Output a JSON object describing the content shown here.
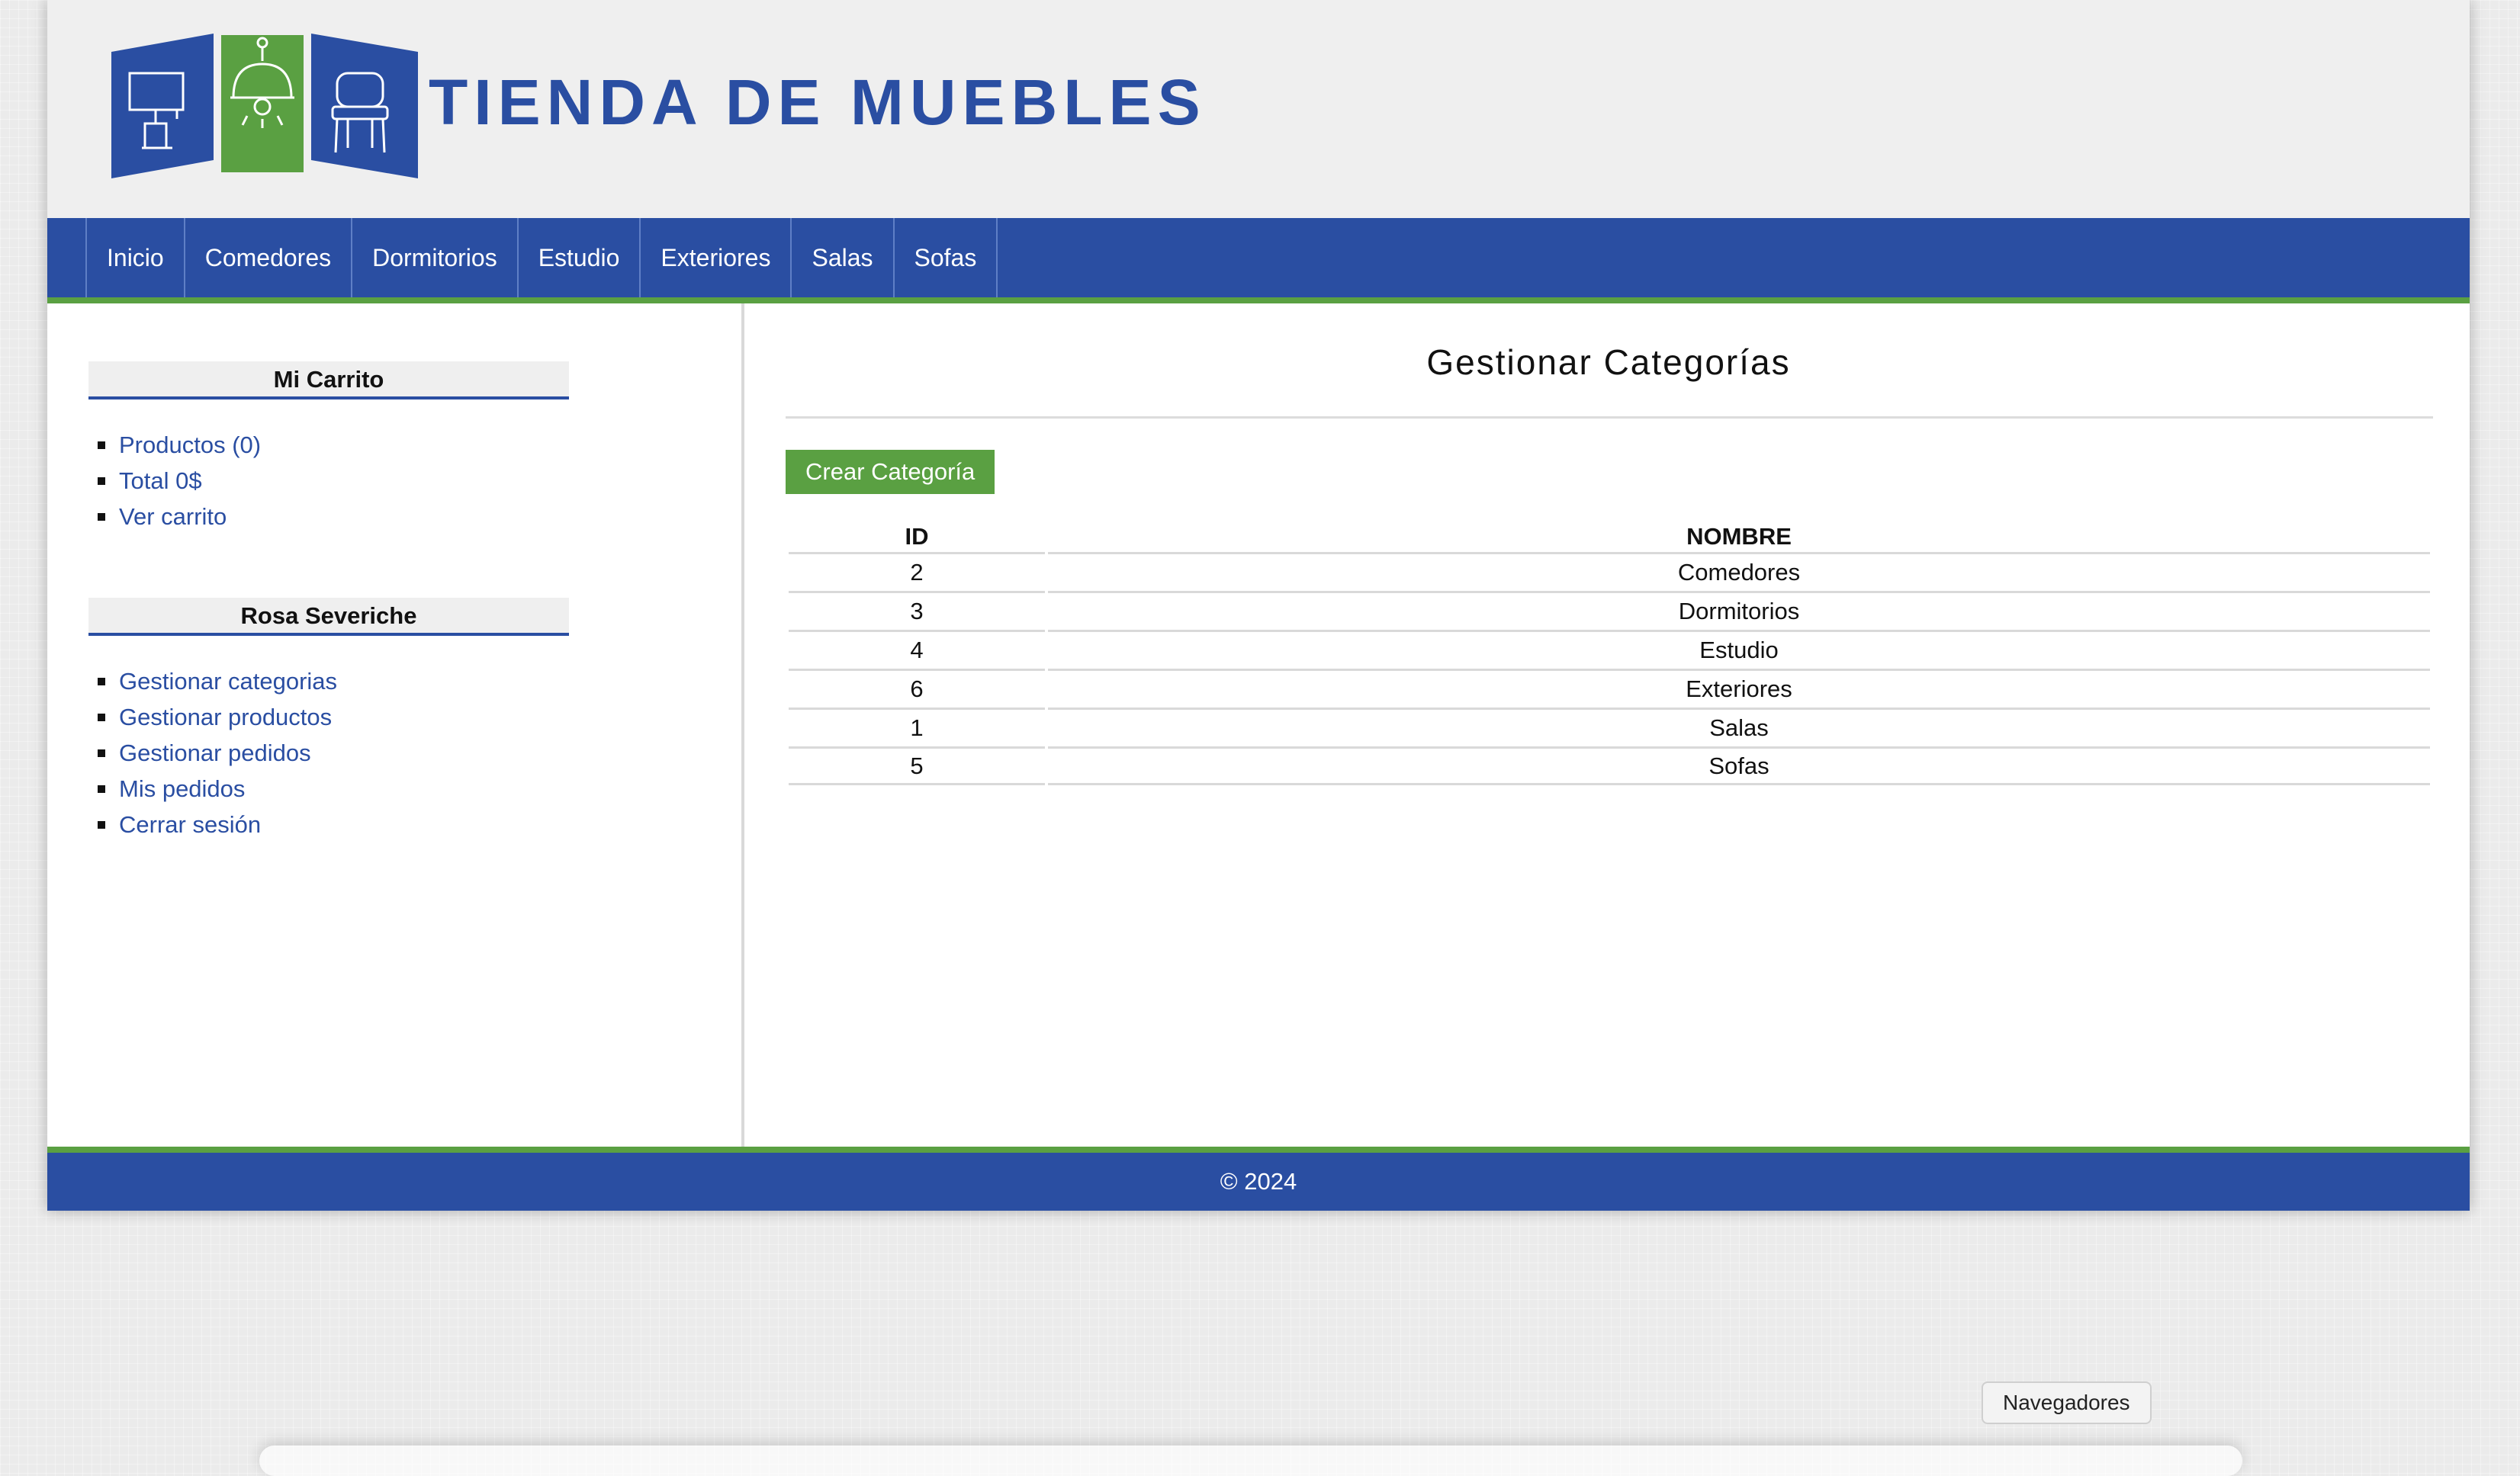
{
  "header": {
    "site_title": "TIENDA DE MUEBLES",
    "logo_icons": [
      "lamp-icon",
      "ceiling-lamp-icon",
      "chair-icon"
    ]
  },
  "nav": {
    "items": [
      "Inicio",
      "Comedores",
      "Dormitorios",
      "Estudio",
      "Exteriores",
      "Salas",
      "Sofas"
    ]
  },
  "cart": {
    "heading": "Mi Carrito",
    "items": [
      "Productos (0)",
      "Total 0$",
      "Ver carrito"
    ]
  },
  "user": {
    "heading": "Rosa Severiche",
    "items": [
      "Gestionar categorias",
      "Gestionar productos",
      "Gestionar pedidos",
      "Mis pedidos",
      "Cerrar sesión"
    ]
  },
  "main": {
    "title": "Gestionar Categorías",
    "create_button": "Crear Categoría",
    "table": {
      "headers": [
        "ID",
        "NOMBRE"
      ],
      "rows": [
        [
          "2",
          "Comedores"
        ],
        [
          "3",
          "Dormitorios"
        ],
        [
          "4",
          "Estudio"
        ],
        [
          "6",
          "Exteriores"
        ],
        [
          "1",
          "Salas"
        ],
        [
          "5",
          "Sofas"
        ]
      ]
    }
  },
  "footer": {
    "text": "© 2024"
  },
  "tooltip": {
    "text": "Navegadores"
  },
  "colors": {
    "brand_blue": "#2a4ea2",
    "accent_green": "#5aa042"
  }
}
